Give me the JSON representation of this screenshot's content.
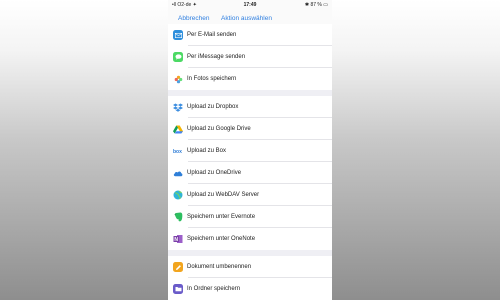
{
  "status_bar": {
    "carrier": "•ll O2-de ✦",
    "time": "17:49",
    "battery": "✱ 87 % ▭"
  },
  "nav": {
    "cancel_label": "Abbrechen",
    "select_action_label": "Aktion auswählen"
  },
  "sections": [
    {
      "items": [
        {
          "label": "Per E-Mail senden",
          "icon": "mail-icon",
          "color": "#2f8fdc"
        },
        {
          "label": "Per iMessage senden",
          "icon": "message-icon",
          "color": "#4cd964"
        },
        {
          "label": "In Fotos speichern",
          "icon": "photos-icon",
          "color": "#f5a623"
        }
      ]
    },
    {
      "items": [
        {
          "label": "Upload zu Dropbox",
          "icon": "dropbox-icon",
          "color": "#3d8ee0"
        },
        {
          "label": "Upload zu Google Drive",
          "icon": "google-drive-icon",
          "color": "#f4b400"
        },
        {
          "label": "Upload zu Box",
          "icon": "box-icon",
          "color": "#2d7cd6"
        },
        {
          "label": "Upload zu OneDrive",
          "icon": "onedrive-icon",
          "color": "#2f7fd8"
        },
        {
          "label": "Upload zu WebDAV Server",
          "icon": "webdav-globe-icon",
          "color": "#2fb4d8"
        },
        {
          "label": "Speichern unter Evernote",
          "icon": "evernote-icon",
          "color": "#2dbe60"
        },
        {
          "label": "Speichern unter OneNote",
          "icon": "onenote-icon",
          "color": "#7b3fa8"
        }
      ]
    },
    {
      "items": [
        {
          "label": "Dokument umbenennen",
          "icon": "pencil-icon",
          "color": "#f2a51f"
        },
        {
          "label": "In Ordner speichern",
          "icon": "folder-icon",
          "color": "#6a5bc9"
        }
      ]
    }
  ]
}
